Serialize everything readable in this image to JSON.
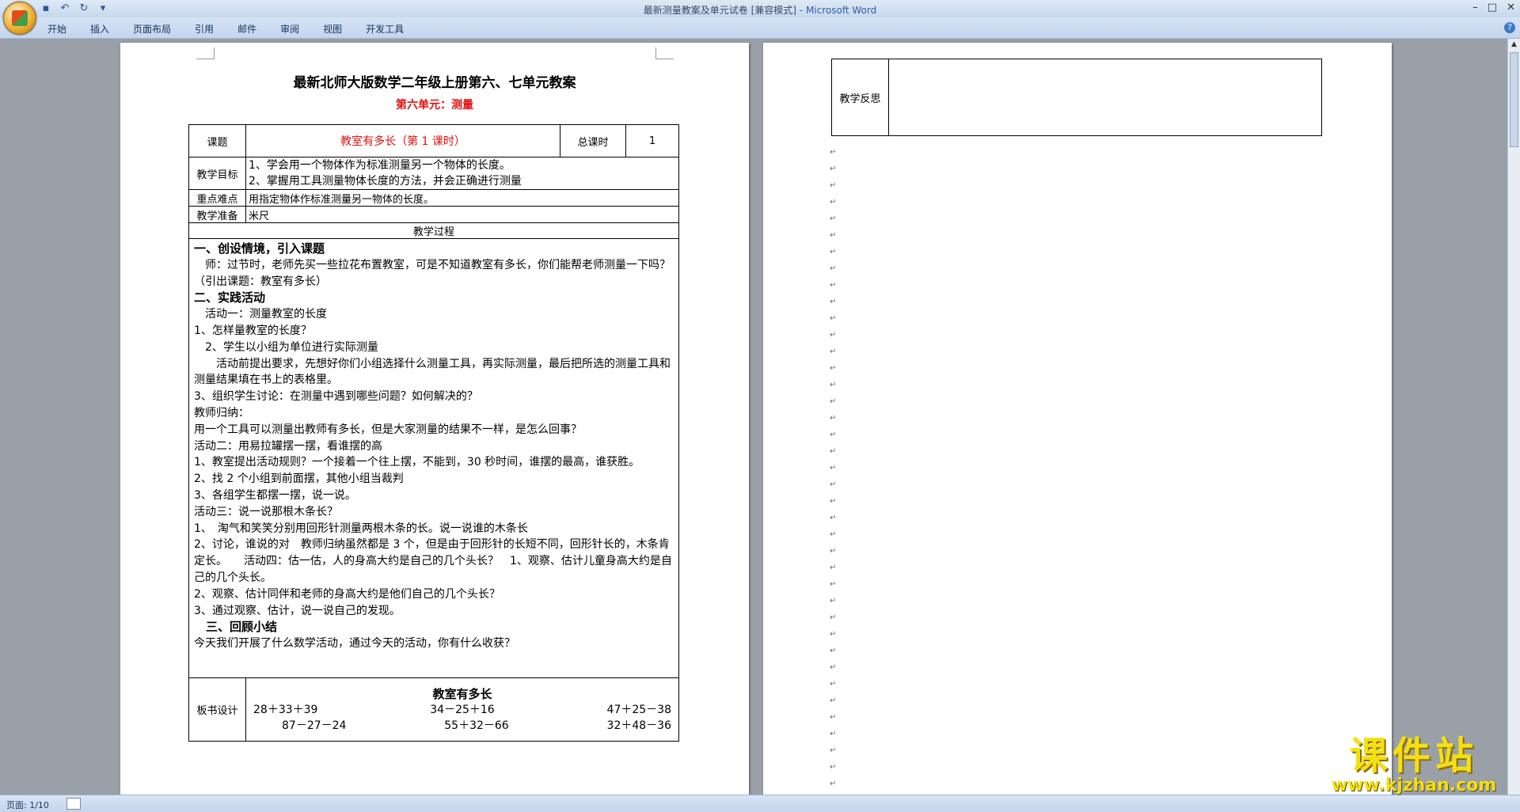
{
  "window": {
    "title": "最新测量教案及单元试卷 [兼容模式]",
    "app_suffix": "- Microsoft Word"
  },
  "qat": {
    "save": "save-icon",
    "undo": "undo-icon",
    "redo": "redo-icon",
    "more": "▾"
  },
  "tabs": [
    "开始",
    "插入",
    "页面布局",
    "引用",
    "邮件",
    "审阅",
    "视图",
    "开发工具"
  ],
  "status": {
    "page": "页面: 1/10"
  },
  "watermark": {
    "line1": "课件站",
    "line2": "www.kjzhan.com"
  },
  "doc": {
    "title": "最新北师大版数学二年级上册第六、七单元教案",
    "subtitle": "第六单元：测量",
    "table": {
      "topic_label": "课题",
      "topic_value": "教室有多长（第 1 课时）",
      "hours_label": "总课时",
      "hours_value": "1",
      "goals_label": "教学目标",
      "goals": [
        "1、学会用一个物体作为标准测量另一个物体的长度。",
        "2、掌握用工具测量物体长度的方法，并会正确进行测量"
      ],
      "key_label": "重点难点",
      "key_value": "用指定物体作标准测量另一物体的长度。",
      "prep_label": "教学准备",
      "prep_value": "米尺",
      "process_label": "教学过程",
      "process": [
        {
          "text": "一、创设情境，引入课题",
          "h": true
        },
        {
          "text": "　师：过节时，老师先买一些拉花布置教室，可是不知道教室有多长，你们能帮老师测量一下吗？（引出课题：教室有多长）",
          "h": false
        },
        {
          "text": "二、实践活动",
          "h": true
        },
        {
          "text": "　活动一：测量教室的长度",
          "h": false
        },
        {
          "text": " 1、怎样量教室的长度？",
          "h": false
        },
        {
          "text": "　2、学生以小组为单位进行实际测量",
          "h": false
        },
        {
          "text": "　　活动前提出要求，先想好你们小组选择什么测量工具，再实际测量，最后把所选的测量工具和测量结果填在书上的表格里。",
          "h": false
        },
        {
          "text": " 3、组织学生讨论：在测量中遇到哪些问题？如何解决的？",
          "h": false
        },
        {
          "text": " 教师归纳：",
          "h": false
        },
        {
          "text": " 用一个工具可以测量出教师有多长，但是大家测量的结果不一样，是怎么回事？",
          "h": false
        },
        {
          "text": " 活动二：用易拉罐摆一摆，看谁摆的高",
          "h": false
        },
        {
          "text": " 1、教室提出活动规则？一个接着一个往上摆，不能到，30 秒时间，谁摆的最高，谁获胜。",
          "h": false
        },
        {
          "text": " 2、找 2 个小组到前面摆，其他小组当裁判",
          "h": false
        },
        {
          "text": " 3、各组学生都摆一摆，说一说。",
          "h": false
        },
        {
          "text": " 活动三：说一说那根木条长？",
          "h": false
        },
        {
          "text": " 1、　淘气和笑笑分别用回形针测量两根木条的长。说一说谁的木条长",
          "h": false
        },
        {
          "text": " 2、讨论，谁说的对　教师归纳虽然都是 3 个，但是由于回形针的长短不同，回形针长的，木条肯定长。　　活动四：估一估，人的身高大约是自己的几个头长？　1、观察、估计儿童身高大约是自己的几个头长。",
          "h": false
        },
        {
          "text": "2、观察、估计同伴和老师的身高大约是他们自己的几个头长？",
          "h": false
        },
        {
          "text": "3、通过观察、估计，说一说自己的发现。",
          "h": false
        },
        {
          "text": "　三、回顾小结",
          "h": true
        },
        {
          "text": "今天我们开展了什么数学活动，通过今天的活动，你有什么收获？",
          "h": false
        }
      ],
      "board_label": "板书设计",
      "board_title": "教室有多长",
      "board_row1": [
        "28＋33＋39",
        "34－25＋16",
        "47＋25－38"
      ],
      "board_row2": [
        "87－27－24",
        "55＋32－66",
        "32＋48－36"
      ]
    },
    "reflection_label": "教学反思"
  }
}
